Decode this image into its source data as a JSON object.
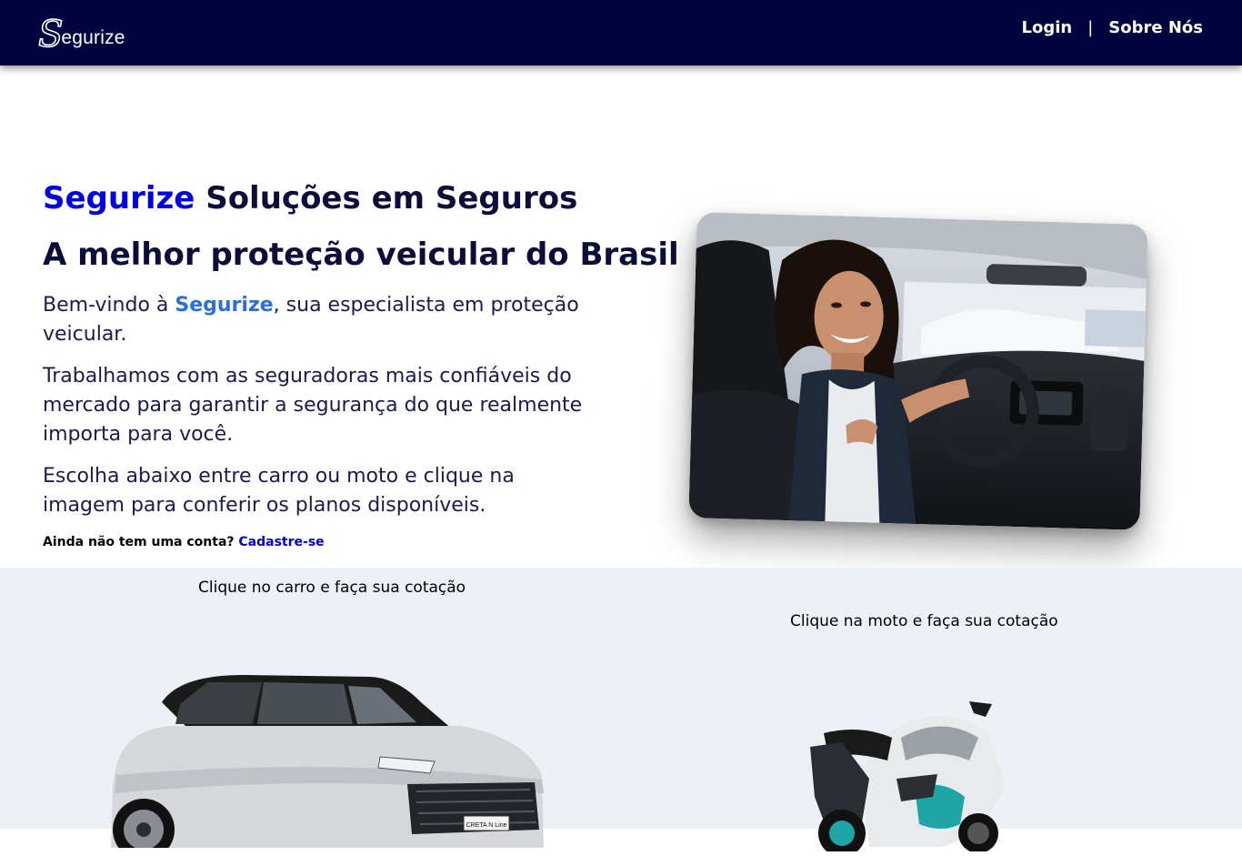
{
  "header": {
    "logo_text": "egurize",
    "logo_letter": "S",
    "nav": {
      "login": "Login",
      "separator": "|",
      "about": "Sobre Nós"
    }
  },
  "hero": {
    "title_brand": "Segurize",
    "title_rest": " Soluções em Seguros",
    "subtitle": "A melhor proteção veicular do Brasil",
    "p1_before": "Bem-vindo à ",
    "p1_brand": "Segurize",
    "p1_after": ", sua especialista em proteção veicular.",
    "p2": "Trabalhamos com as seguradoras mais confiáveis do mercado para garantir a segurança do que realmente importa para você.",
    "p3": "Escolha abaixo entre carro ou moto e clique na imagem para conferir os planos disponíveis.",
    "signup_prompt": "Ainda não tem uma conta?",
    "signup_link": "Cadastre-se"
  },
  "quote": {
    "car_caption": "Clique no carro e faça sua cotação",
    "moto_caption": "Clique na moto e faça sua cotação",
    "car_plate": "CRETA N Line"
  },
  "colors": {
    "header_bg": "#02023f",
    "brand_blue": "#0000e6",
    "brand_light": "#2a6fdb",
    "section_bg": "#edf0f7"
  }
}
